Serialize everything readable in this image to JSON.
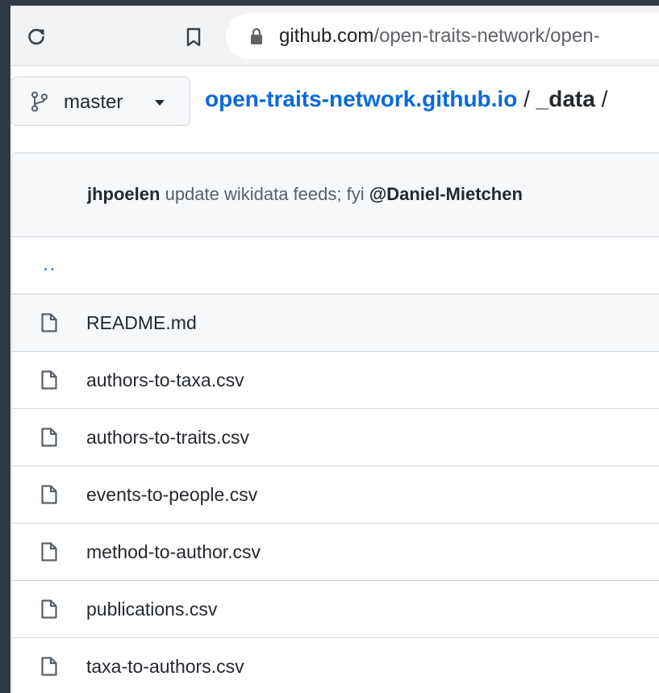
{
  "browser": {
    "url_host": "github.com",
    "url_path": "/open-traits-network/open-"
  },
  "branch": {
    "label": "master"
  },
  "breadcrumb": {
    "repo": "open-traits-network.github.io",
    "separator": "/",
    "current": "_data",
    "trailing_separator": "/"
  },
  "commit": {
    "author": "jhpoelen",
    "message": "update wikidata feeds; fyi",
    "mention": "@Daniel-Mietchen"
  },
  "parent_dir": "..",
  "files": [
    {
      "name": "README.md",
      "icon": "file-icon"
    },
    {
      "name": "authors-to-taxa.csv",
      "icon": "file-icon"
    },
    {
      "name": "authors-to-traits.csv",
      "icon": "file-icon"
    },
    {
      "name": "events-to-people.csv",
      "icon": "file-icon"
    },
    {
      "name": "method-to-author.csv",
      "icon": "file-icon"
    },
    {
      "name": "publications.csv",
      "icon": "file-icon"
    },
    {
      "name": "taxa-to-authors.csv",
      "icon": "file-icon"
    }
  ],
  "colors": {
    "link_blue": "#0969da",
    "text_dark": "#24292f",
    "muted": "#57606a",
    "header_bg": "#f6f8fa",
    "border": "#d0d7de",
    "backdrop": "#2f3a44"
  }
}
